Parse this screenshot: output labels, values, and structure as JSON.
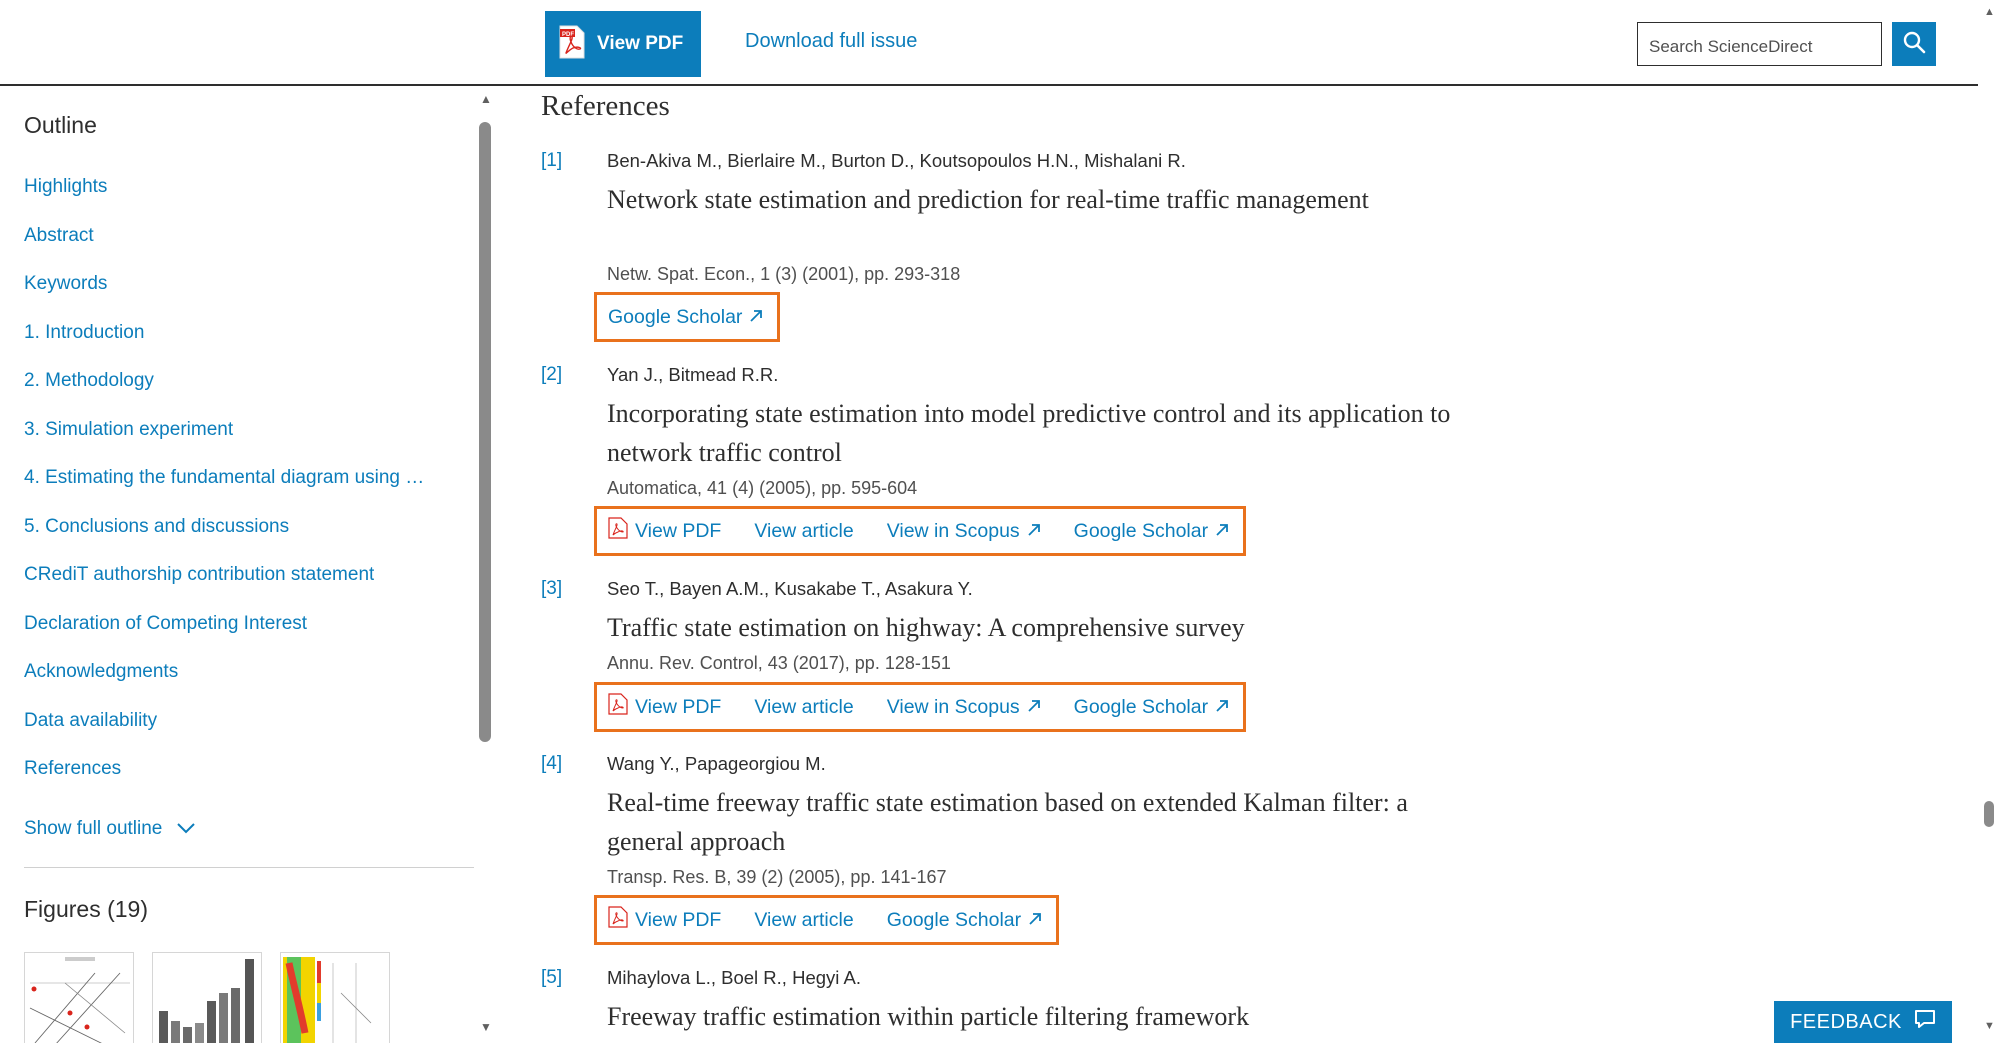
{
  "toolbar": {
    "view_pdf_label": "View PDF",
    "download_issue_label": "Download full issue",
    "search_placeholder": "Search ScienceDirect"
  },
  "sidebar": {
    "outline_title": "Outline",
    "items": [
      {
        "label": "Highlights"
      },
      {
        "label": "Abstract"
      },
      {
        "label": "Keywords"
      },
      {
        "label": "1. Introduction"
      },
      {
        "label": "2. Methodology"
      },
      {
        "label": "3. Simulation experiment"
      },
      {
        "label": "4. Estimating the fundamental diagram using …"
      },
      {
        "label": "5. Conclusions and discussions"
      },
      {
        "label": "CRediT authorship contribution statement"
      },
      {
        "label": "Declaration of Competing Interest"
      },
      {
        "label": "Acknowledgments"
      },
      {
        "label": "Data availability"
      },
      {
        "label": "References"
      }
    ],
    "show_full_outline_label": "Show full outline",
    "figures_title": "Figures (19)"
  },
  "main": {
    "heading": "References",
    "references": [
      {
        "num": "[1]",
        "authors": "Ben-Akiva M., Bierlaire M., Burton D., Koutsopoulos H.N., Mishalani R.",
        "title": "Network state estimation and prediction for real-time traffic management",
        "source": "Netw. Spat. Econ., 1 (3) (2001), pp. 293-318",
        "links": [
          "Google Scholar"
        ]
      },
      {
        "num": "[2]",
        "authors": "Yan J., Bitmead R.R.",
        "title": "Incorporating state estimation into model predictive control and its application to network traffic control",
        "source": "Automatica, 41 (4) (2005), pp. 595-604",
        "links": [
          "View PDF",
          "View article",
          "View in Scopus",
          "Google Scholar"
        ]
      },
      {
        "num": "[3]",
        "authors": "Seo T., Bayen A.M., Kusakabe T., Asakura Y.",
        "title": "Traffic state estimation on highway: A comprehensive survey",
        "source": "Annu. Rev. Control, 43 (2017), pp. 128-151",
        "links": [
          "View PDF",
          "View article",
          "View in Scopus",
          "Google Scholar"
        ]
      },
      {
        "num": "[4]",
        "authors": "Wang Y., Papageorgiou M.",
        "title": "Real-time freeway traffic state estimation based on extended Kalman filter: a general approach",
        "source": "Transp. Res. B, 39 (2) (2005), pp. 141-167",
        "links": [
          "View PDF",
          "View article",
          "Google Scholar"
        ]
      },
      {
        "num": "[5]",
        "authors": "Mihaylova L., Boel R., Hegyi A.",
        "title": "Freeway traffic estimation within particle filtering framework"
      }
    ]
  },
  "feedback_label": "FEEDBACK",
  "colors": {
    "accent": "#0c7dbb",
    "highlight_box": "#e9711c",
    "pdf_red": "#d9241c"
  }
}
